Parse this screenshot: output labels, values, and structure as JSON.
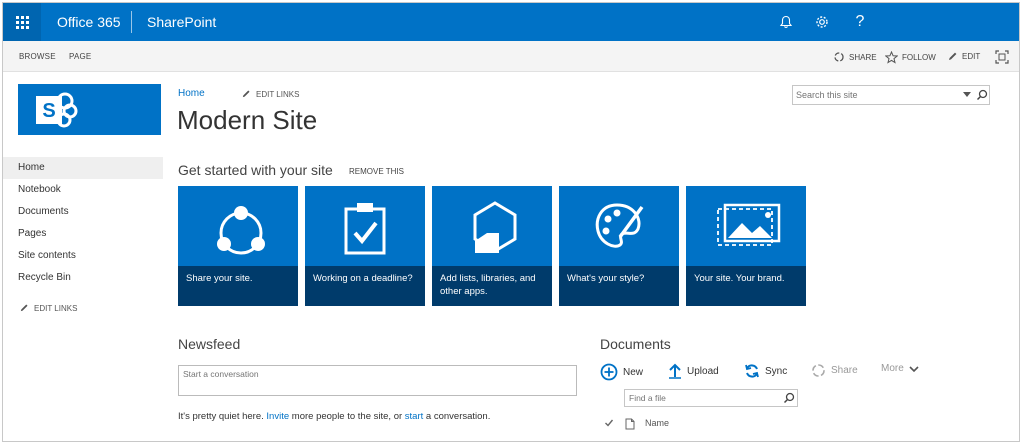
{
  "suite": {
    "brand": "Office 365",
    "product": "SharePoint"
  },
  "ribbon": {
    "tabs": [
      "BROWSE",
      "PAGE"
    ],
    "share_label": "SHARE",
    "follow_label": "FOLLOW",
    "edit_label": "EDIT"
  },
  "site": {
    "title": "Modern Site"
  },
  "breadcrumb": {
    "home": "Home",
    "edit_links": "EDIT LINKS"
  },
  "search": {
    "placeholder": "Search this site"
  },
  "quicklaunch": {
    "items": [
      "Home",
      "Notebook",
      "Documents",
      "Pages",
      "Site contents",
      "Recycle Bin"
    ],
    "edit_links": "EDIT LINKS"
  },
  "get_started": {
    "title": "Get started with your site",
    "remove": "REMOVE THIS",
    "tiles": [
      {
        "caption": "Share your site.",
        "icon": "share-icon"
      },
      {
        "caption": "Working on a deadline?",
        "icon": "clipboard-check-icon"
      },
      {
        "caption": "Add lists, libraries, and other apps.",
        "icon": "apps-hexagon-icon"
      },
      {
        "caption": "What's your style?",
        "icon": "palette-icon"
      },
      {
        "caption": "Your site. Your brand.",
        "icon": "brand-image-icon"
      }
    ]
  },
  "newsfeed": {
    "title": "Newsfeed",
    "placeholder": "Start a conversation",
    "quiet_before": "It's pretty quiet here. ",
    "invite_link": "Invite",
    "quiet_middle": " more people to the site, or ",
    "start_link": "start",
    "quiet_after": " a conversation."
  },
  "documents": {
    "title": "Documents",
    "commands": {
      "new": "New",
      "upload": "Upload",
      "sync": "Sync",
      "share": "Share",
      "more": "More"
    },
    "find_placeholder": "Find a file",
    "column_name": "Name"
  },
  "colors": {
    "suite_blue": "#0072c6",
    "tile_caption": "#003b6b"
  }
}
